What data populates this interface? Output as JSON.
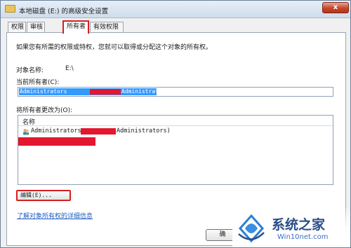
{
  "window": {
    "title": "本地磁盘 (E:) 的高级安全设置",
    "close_glyph": "x"
  },
  "tabs": [
    {
      "label": "权限",
      "active": false
    },
    {
      "label": "审核",
      "active": false
    },
    {
      "label": "所有者",
      "active": true
    },
    {
      "label": "有效权限",
      "active": false
    }
  ],
  "owner_tab": {
    "intro": "如果您有所需的权限或特权，您就可以取得或分配这个对象的所有权。",
    "object_name_label": "对象名称:",
    "object_name_value": "E:\\",
    "current_owner_label": "当前所有者(C):",
    "current_owner_value_prefix": "Administrators",
    "current_owner_value_suffix": "Administrators)",
    "change_owner_label": "将所有者更改为(O):",
    "list": {
      "column_header": "名称",
      "rows": [
        {
          "prefix": "Administrators",
          "suffix": "Administrators)",
          "icon": "user-group-icon"
        }
      ]
    },
    "edit_button": "编辑(E)...",
    "learn_more_link": "了解对象所有权的详细信息",
    "ok_button": "确"
  },
  "watermark": {
    "text_main": "系统之家",
    "text_url": "Win10net.com"
  },
  "colors": {
    "redaction": "#e3172f",
    "highlight_border": "#d32020",
    "selection": "#3399ff",
    "link": "#1f5ebf"
  }
}
